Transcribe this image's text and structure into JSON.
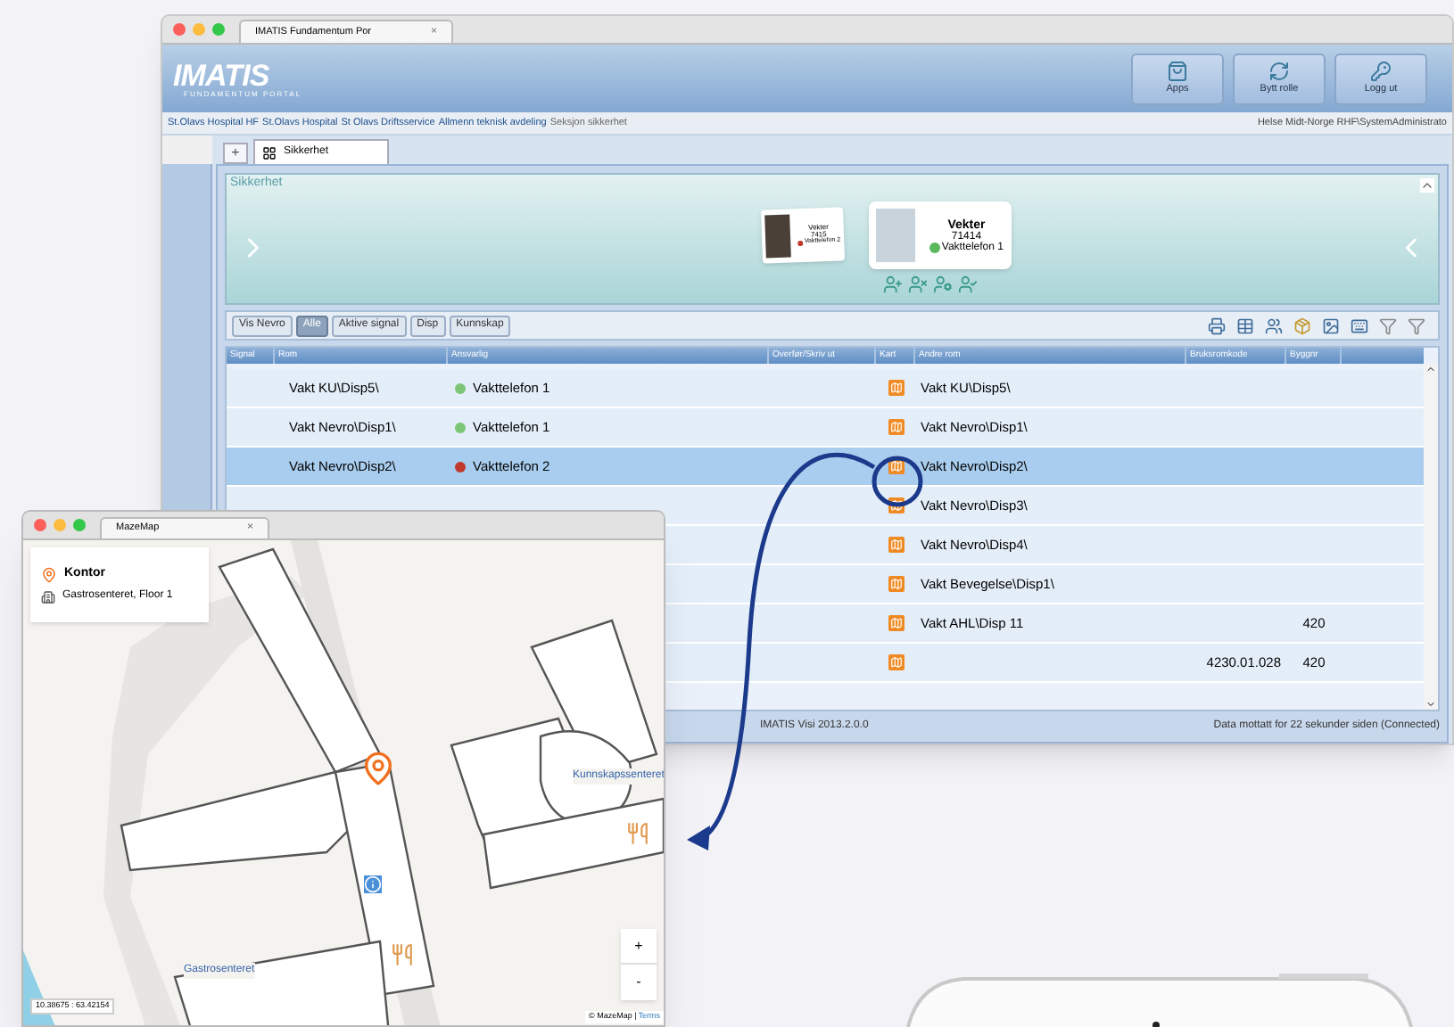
{
  "main_window": {
    "tab_title": "IMATIS Fundamentum Por",
    "tab_close": "×",
    "logo": {
      "name": "IMATIS",
      "tagline": "FUNDAMENTUM PORTAL"
    },
    "header_buttons": [
      {
        "label": "Apps",
        "kind": "apps"
      },
      {
        "label": "Bytt rolle",
        "kind": "switch"
      },
      {
        "label": "Logg ut",
        "kind": "logout"
      }
    ],
    "breadcrumbs": [
      {
        "label": "St.Olavs Hospital HF",
        "selected": false
      },
      {
        "label": "St.Olavs Hospital",
        "selected": false
      },
      {
        "label": "St Olavs Driftsservice",
        "selected": false
      },
      {
        "label": "Allmenn teknisk avdeling",
        "selected": false
      },
      {
        "label": "Seksjon sikkerhet",
        "selected": true
      }
    ],
    "user": "Helse Midt-Norge RHF\\SystemAdministrato",
    "add_tab": "+",
    "tabs": [
      {
        "label": "Sikkerhet",
        "selected": true
      }
    ],
    "panel": {
      "title": "Sikkerhet",
      "cards": [
        {
          "kind": "small",
          "title": "Vekter",
          "number": "7415",
          "phone": "Vakttelefon 2",
          "color": "#c0392b"
        },
        {
          "kind": "large",
          "title": "Vekter",
          "number": "71414",
          "phone": "Vakttelefon 1",
          "color": "#5cb85c"
        }
      ]
    },
    "filters": [
      {
        "label": "Vis Nevro",
        "selected": false
      },
      {
        "label": "Alle",
        "selected": true
      },
      {
        "label": "Aktive signal",
        "selected": false
      },
      {
        "label": "Disp",
        "selected": false
      },
      {
        "label": "Kunnskap",
        "selected": false
      }
    ],
    "table": {
      "columns": [
        "Signal",
        "Rom",
        "Ansvarlig",
        "Overfør/Skriv ut",
        "Kart",
        "Andre rom",
        "Bruksromkode",
        "Byggnr"
      ],
      "rows": [
        {
          "rom": "Vakt KU\\Disp5\\",
          "ansvarlig": "Vakttelefon 1",
          "color": "#7cc576",
          "andre_rom": "Vakt KU\\Disp5\\",
          "selected": false
        },
        {
          "rom": "Vakt Nevro\\Disp1\\",
          "ansvarlig": "Vakttelefon 1",
          "color": "#7cc576",
          "andre_rom": "Vakt Nevro\\Disp1\\",
          "selected": false
        },
        {
          "rom": "Vakt Nevro\\Disp2\\",
          "ansvarlig": "Vakttelefon 2",
          "color": "#c0392b",
          "andre_rom": "Vakt Nevro\\Disp2\\",
          "selected": true
        },
        {
          "andre_rom": "Vakt Nevro\\Disp3\\",
          "selected": false
        },
        {
          "andre_rom": "Vakt Nevro\\Disp4\\",
          "selected": false
        },
        {
          "andre_rom": "Vakt Bevegelse\\Disp1\\",
          "selected": false
        },
        {
          "andre_rom": "Vakt AHL\\Disp 11",
          "byggnr": "420",
          "selected": false
        },
        {
          "bruksromkode": "4230.01.028",
          "byggnr": "420",
          "selected": false
        }
      ]
    },
    "status_bar": {
      "version": "IMATIS Visi 2013.2.0.0",
      "message": "Data mottatt for 22 sekunder siden (Connected)"
    }
  },
  "map_window": {
    "tab_title": "MazeMap",
    "tab_close": "×",
    "place": {
      "name": "Kontor",
      "building": "Gastrosenteret, Floor 1"
    },
    "labels": [
      "Gastrosenteret",
      "Kunnskapssenteret"
    ],
    "zoom_in": "+",
    "zoom_out": "-",
    "coordinates": "10.38675 : 63.42154",
    "attribution": "© MazeMap |",
    "terms_link": "Terms"
  }
}
